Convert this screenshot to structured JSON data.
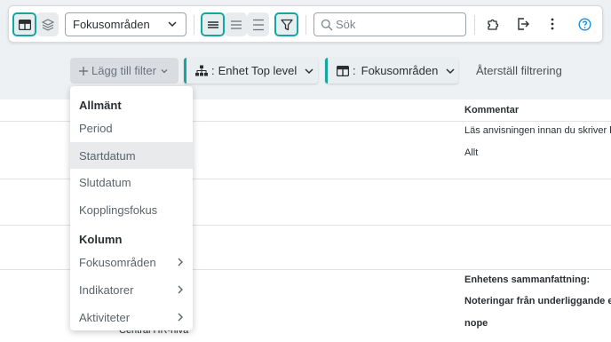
{
  "toolbar": {
    "view_select_value": "Fokusområden",
    "search_placeholder": "Sök"
  },
  "filterbar": {
    "add_filter_label": "Lägg till filter",
    "chip_unit_label": "Enhet Top level",
    "chip_focus_label": "Fokusområden",
    "reset_label": "Återställ filtrering"
  },
  "table": {
    "comment_header": "Kommentar",
    "row1_line1": "Läs anvisningen innan du skriver k",
    "row1_line2": "Allt",
    "row4_line1": "Enhetens sammanfattning:",
    "row4_line2": "Noteringar från underliggande enh",
    "row4_line3": "nope",
    "ghost_text": "Central HR-nivå"
  },
  "dropdown": {
    "section_general": "Allmänt",
    "period": "Period",
    "startdatum": "Startdatum",
    "slutdatum": "Slutdatum",
    "kopplingsfokus": "Kopplingsfokus",
    "section_column": "Kolumn",
    "fokusomraden": "Fokusområden",
    "indikatorer": "Indikatorer",
    "aktiviteter": "Aktiviteter"
  },
  "colors": {
    "accent": "#15a6a0",
    "toolbar_bg": "#eef1f4",
    "help": "#1a8fd6"
  }
}
